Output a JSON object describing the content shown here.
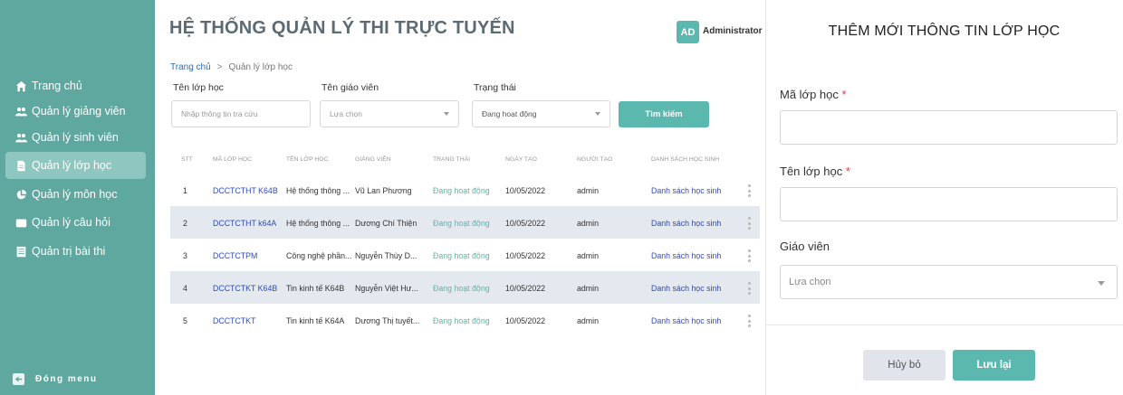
{
  "app": {
    "title": "HỆ THỐNG QUẢN LÝ THI TRỰC TUYẾN"
  },
  "user": {
    "avatar": "AD",
    "name": "Administrator"
  },
  "sidebar": {
    "items": [
      {
        "label": "Trang chủ",
        "icon": "home-icon"
      },
      {
        "label": "Quản lý giảng viên",
        "icon": "users-icon"
      },
      {
        "label": "Quản lý sinh viên",
        "icon": "users-icon"
      },
      {
        "label": "Quản lý lớp học",
        "icon": "document-icon",
        "active": true
      },
      {
        "label": "Quản lý môn học",
        "icon": "pie-chart-icon"
      },
      {
        "label": "Quản lý câu hỏi",
        "icon": "box-icon"
      },
      {
        "label": "Quản trị bài thi",
        "icon": "list-icon"
      }
    ],
    "close_menu": "Đóng menu"
  },
  "breadcrumb": {
    "home": "Trang chủ",
    "separator": ">",
    "current": "Quản lý lớp học"
  },
  "filters": {
    "class_name_label": "Tên lớp học",
    "class_name_placeholder": "Nhập thông tin tra cứu",
    "teacher_label": "Tên giáo viên",
    "teacher_value": "Lựa chọn",
    "status_label": "Trạng thái",
    "status_value": "Đang hoạt động",
    "search_button": "Tìm kiếm"
  },
  "table": {
    "headers": [
      "STT",
      "MÃ LỚP HỌC",
      "TÊN LỚP HỌC",
      "GIẢNG VIÊN",
      "TRẠNG THÁI",
      "NGÀY TẠO",
      "NGƯỜI TẠO",
      "DANH SÁCH HỌC SINH"
    ],
    "rows": [
      {
        "stt": "1",
        "code": "DCCTCTHT K64B",
        "name": "Hệ thống thông ...",
        "teacher": "Vũ Lan Phương",
        "status": "Đang hoạt động",
        "date": "10/05/2022",
        "creator": "admin",
        "list": "Danh sách học sinh"
      },
      {
        "stt": "2",
        "code": "DCCTCTHT k64A",
        "name": "Hệ thống thông ...",
        "teacher": "Dương Chí Thiện",
        "status": "Đang hoạt động",
        "date": "10/05/2022",
        "creator": "admin",
        "list": "Danh sách học sinh"
      },
      {
        "stt": "3",
        "code": "DCCTCTPM",
        "name": "Công nghệ phần...",
        "teacher": "Nguyễn Thùy D...",
        "status": "Đang hoạt động",
        "date": "10/05/2022",
        "creator": "admin",
        "list": "Danh sách học sinh"
      },
      {
        "stt": "4",
        "code": "DCCTCTKT K64B",
        "name": "Tin kinh tế K64B",
        "teacher": "Nguyễn Việt Hư...",
        "status": "Đang hoạt động",
        "date": "10/05/2022",
        "creator": "admin",
        "list": "Danh sách học sinh"
      },
      {
        "stt": "5",
        "code": "DCCTCTKT",
        "name": "Tin kinh tế K64A",
        "teacher": "Dương Thị tuyết...",
        "status": "Đang hoạt động",
        "date": "10/05/2022",
        "creator": "admin",
        "list": "Danh sách học sinh"
      }
    ]
  },
  "panel": {
    "title": "THÊM MỚI THÔNG TIN LỚP HỌC",
    "code_label": "Mã lớp học",
    "name_label": "Tên lớp học",
    "required_mark": "*",
    "teacher_label": "Giáo viên",
    "teacher_placeholder": "Lựa chọn",
    "cancel_button": "Hủy bỏ",
    "save_button": "Lưu lại"
  },
  "colors": {
    "sidebar": "#5fa8a0",
    "accent": "#5bb8ae",
    "link": "#2f4bb3"
  }
}
